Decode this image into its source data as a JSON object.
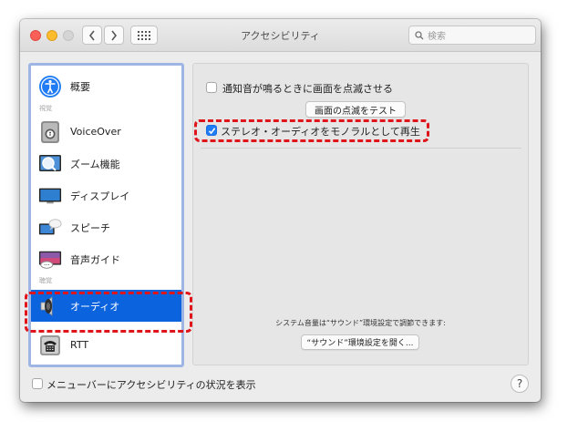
{
  "window": {
    "title": "アクセシビリティ",
    "search_placeholder": "検索"
  },
  "sidebar": {
    "items": [
      {
        "label": "概要",
        "icon": "accessibility-icon"
      },
      {
        "label": "VoiceOver",
        "icon": "voiceover-icon"
      },
      {
        "label": "ズーム機能",
        "icon": "zoom-icon"
      },
      {
        "label": "ディスプレイ",
        "icon": "display-icon"
      },
      {
        "label": "スピーチ",
        "icon": "speech-icon"
      },
      {
        "label": "音声ガイド",
        "icon": "descriptions-icon"
      },
      {
        "label": "オーディオ",
        "icon": "speaker-icon",
        "selected": true
      },
      {
        "label": "RTT",
        "icon": "rtt-icon"
      }
    ],
    "sections": {
      "vision": "視覚",
      "hearing": "聴覚"
    }
  },
  "pane": {
    "flash_screen_label": "通知音が鳴るときに画面を点滅させる",
    "flash_screen_checked": false,
    "test_flash_button": "画面の点滅をテスト",
    "mono_audio_label": "ステレオ・オーディオをモノラルとして再生",
    "mono_audio_checked": true,
    "volume_note": "システム音量は“サウンド”環境設定で調節できます:",
    "open_sound_button": "“サウンド”環境設定を開く..."
  },
  "footer": {
    "menubar_status_label": "メニューバーにアクセシビリティの状況を表示",
    "menubar_status_checked": false,
    "help_label": "?"
  },
  "colors": {
    "selection": "#0b63dd",
    "highlight": "#e0141b",
    "checkbox_checked": "#1f7cf5"
  }
}
